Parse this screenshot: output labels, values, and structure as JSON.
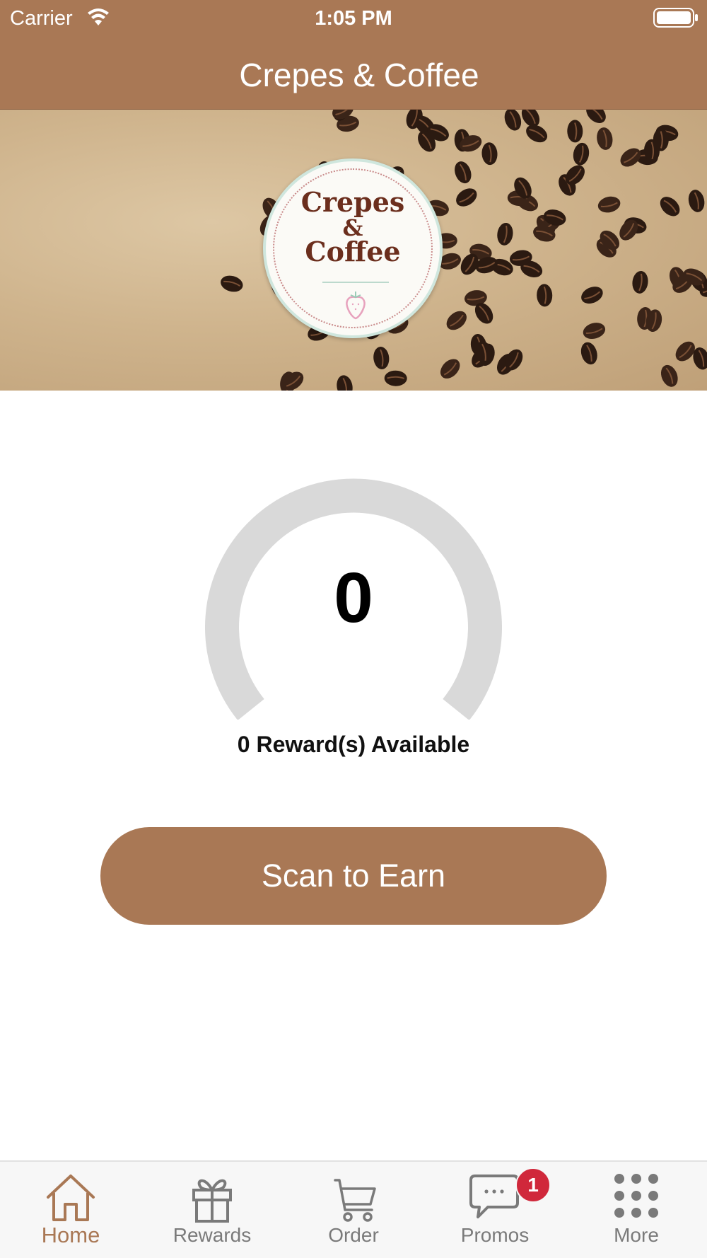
{
  "status_bar": {
    "carrier": "Carrier",
    "time": "1:05 PM"
  },
  "nav": {
    "title": "Crepes & Coffee"
  },
  "logo": {
    "line1": "Crepes",
    "line2": "&",
    "line3": "Coffee"
  },
  "rewards": {
    "points": "0",
    "available_text": "0 Reward(s) Available"
  },
  "actions": {
    "scan_label": "Scan to Earn"
  },
  "tabs": [
    {
      "label": "Home",
      "icon": "home-icon",
      "active": true
    },
    {
      "label": "Rewards",
      "icon": "gift-icon",
      "active": false
    },
    {
      "label": "Order",
      "icon": "cart-icon",
      "active": false
    },
    {
      "label": "Promos",
      "icon": "chat-bubble-icon",
      "active": false,
      "badge": "1"
    },
    {
      "label": "More",
      "icon": "grid-dots-icon",
      "active": false
    }
  ],
  "colors": {
    "brand": "#a97855",
    "gauge_track": "#d9d9d9",
    "badge": "#d0283b",
    "tab_inactive": "#7a7a7a"
  }
}
